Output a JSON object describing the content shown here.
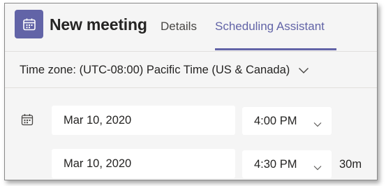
{
  "header": {
    "title": "New meeting",
    "app_icon": "calendar-icon",
    "accent_color": "#6264a7",
    "tabs": [
      {
        "label": "Details",
        "active": false
      },
      {
        "label": "Scheduling Assistant",
        "active": true
      }
    ]
  },
  "timezone": {
    "label": "Time zone: (UTC-08:00) Pacific Time (US & Canada)",
    "icon": "chevron-down-icon"
  },
  "schedule": {
    "row_icon": "calendar-icon",
    "start": {
      "date": "Mar 10, 2020",
      "time": "4:00 PM"
    },
    "end": {
      "date": "Mar 10, 2020",
      "time": "4:30 PM"
    },
    "duration": "30m"
  }
}
